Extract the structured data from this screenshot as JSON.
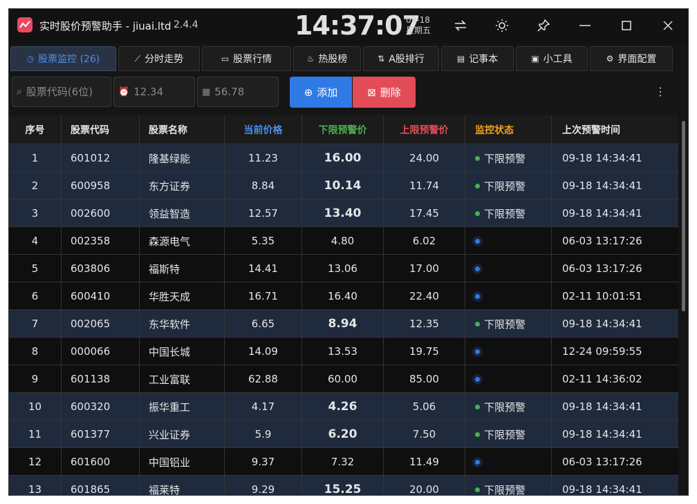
{
  "app": {
    "title": "实时股价预警助手 - jiuai.ltd",
    "version": "2.4.4",
    "clock_time": "14:37:07",
    "clock_date": "09-18",
    "clock_weekday": "星期五"
  },
  "tabs": [
    {
      "label": "股票监控 (26)",
      "icon": "clock-icon",
      "active": true
    },
    {
      "label": "分时走势",
      "icon": "line-chart-icon"
    },
    {
      "label": "股票行情",
      "icon": "book-icon"
    },
    {
      "label": "热股榜",
      "icon": "flame-icon"
    },
    {
      "label": "A股排行",
      "icon": "sort-icon"
    },
    {
      "label": "记事本",
      "icon": "note-icon"
    },
    {
      "label": "小工具",
      "icon": "tools-icon"
    },
    {
      "label": "界面配置",
      "icon": "gear-icon"
    }
  ],
  "toolbar": {
    "code_placeholder": "股票代码(6位)",
    "low_placeholder": "12.34",
    "high_placeholder": "56.78",
    "add_label": "添加",
    "delete_label": "删除"
  },
  "table": {
    "headers": [
      "序号",
      "股票代码",
      "股票名称",
      "当前价格",
      "下限预警价",
      "上限预警价",
      "监控状态",
      "上次预警时间"
    ],
    "header_colors": {
      "current": "#4b8ff0",
      "low": "#4caf50",
      "high": "#e34c57",
      "status": "#f0a020"
    },
    "rows": [
      {
        "no": "1",
        "code": "601012",
        "name": "隆基绿能",
        "price": "11.23",
        "low": "16.00",
        "high": "24.00",
        "status": "下限预警",
        "time": "09-18 14:34:41",
        "alert": true
      },
      {
        "no": "2",
        "code": "600958",
        "name": "东方证券",
        "price": "8.84",
        "low": "10.14",
        "high": "11.74",
        "status": "下限预警",
        "time": "09-18 14:34:41",
        "alert": true
      },
      {
        "no": "3",
        "code": "002600",
        "name": "领益智造",
        "price": "12.57",
        "low": "13.40",
        "high": "17.45",
        "status": "下限预警",
        "time": "09-18 14:34:41",
        "alert": true
      },
      {
        "no": "4",
        "code": "002358",
        "name": "森源电气",
        "price": "5.35",
        "low": "4.80",
        "high": "6.02",
        "status": "",
        "time": "06-03 13:17:26",
        "alert": false
      },
      {
        "no": "5",
        "code": "603806",
        "name": "福斯特",
        "price": "14.41",
        "low": "13.06",
        "high": "17.00",
        "status": "",
        "time": "06-03 13:17:26",
        "alert": false
      },
      {
        "no": "6",
        "code": "600410",
        "name": "华胜天成",
        "price": "16.71",
        "low": "16.40",
        "high": "22.40",
        "status": "",
        "time": "02-11 10:01:51",
        "alert": false
      },
      {
        "no": "7",
        "code": "002065",
        "name": "东华软件",
        "price": "6.65",
        "low": "8.94",
        "high": "12.35",
        "status": "下限预警",
        "time": "09-18 14:34:41",
        "alert": true
      },
      {
        "no": "8",
        "code": "000066",
        "name": "中国长城",
        "price": "14.09",
        "low": "13.53",
        "high": "19.75",
        "status": "",
        "time": "12-24 09:59:55",
        "alert": false
      },
      {
        "no": "9",
        "code": "601138",
        "name": "工业富联",
        "price": "62.88",
        "low": "60.00",
        "high": "85.00",
        "status": "",
        "time": "02-11 14:36:02",
        "alert": false
      },
      {
        "no": "10",
        "code": "600320",
        "name": "振华重工",
        "price": "4.17",
        "low": "4.26",
        "high": "5.06",
        "status": "下限预警",
        "time": "09-18 14:34:41",
        "alert": true
      },
      {
        "no": "11",
        "code": "601377",
        "name": "兴业证券",
        "price": "5.9",
        "low": "6.20",
        "high": "7.50",
        "status": "下限预警",
        "time": "09-18 14:34:41",
        "alert": true
      },
      {
        "no": "12",
        "code": "601600",
        "name": "中国铝业",
        "price": "9.37",
        "low": "7.32",
        "high": "11.49",
        "status": "",
        "time": "06-03 13:17:26",
        "alert": false
      },
      {
        "no": "13",
        "code": "601865",
        "name": "福莱特",
        "price": "9.29",
        "low": "15.25",
        "high": "20.00",
        "status": "下限预警",
        "time": "09-18 14:34:41",
        "alert": true
      }
    ]
  }
}
